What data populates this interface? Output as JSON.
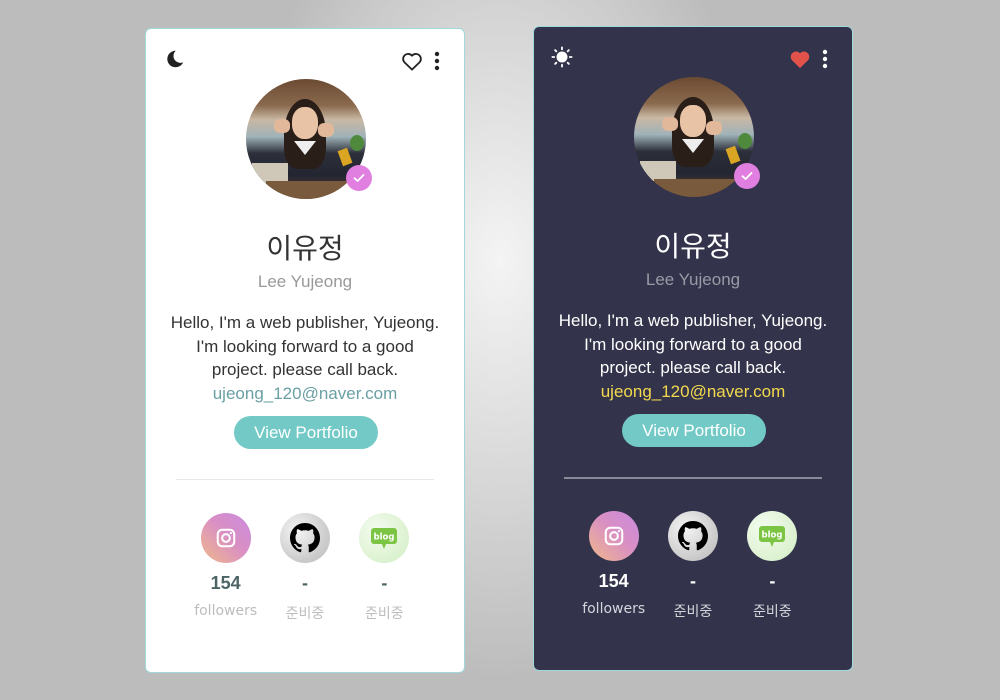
{
  "cards": [
    {
      "theme": "light",
      "theme_toggle_icon": "moon-icon",
      "favorite_icon": "heart-outline-icon",
      "favorited": false,
      "menu_icon": "more-vertical-icon",
      "verified_icon": "check-badge-icon",
      "name_ko": "이유정",
      "name_en": "Lee Yujeong",
      "bio": "Hello, I'm a web publisher, Yujeong. I'm looking forward to a good project. please call back.",
      "email": "ujeong_120@naver.com",
      "portfolio_button": "View Portfolio",
      "socials": [
        {
          "platform": "instagram",
          "icon": "instagram-icon",
          "count": "154",
          "label": "followers"
        },
        {
          "platform": "github",
          "icon": "github-icon",
          "count": "-",
          "label": "준비중"
        },
        {
          "platform": "blog",
          "icon": "naver-blog-icon",
          "icon_text": "blog",
          "count": "-",
          "label": "준비중"
        }
      ]
    },
    {
      "theme": "dark",
      "theme_toggle_icon": "sun-icon",
      "favorite_icon": "heart-filled-icon",
      "favorited": true,
      "menu_icon": "more-vertical-icon",
      "verified_icon": "check-badge-icon",
      "name_ko": "이유정",
      "name_en": "Lee Yujeong",
      "bio": "Hello, I'm a web publisher, Yujeong. I'm looking forward to a good project. please call back.",
      "email": "ujeong_120@naver.com",
      "portfolio_button": "View Portfolio",
      "socials": [
        {
          "platform": "instagram",
          "icon": "instagram-icon",
          "count": "154",
          "label": "followers"
        },
        {
          "platform": "github",
          "icon": "github-icon",
          "count": "-",
          "label": "준비중"
        },
        {
          "platform": "blog",
          "icon": "naver-blog-icon",
          "icon_text": "blog",
          "count": "-",
          "label": "준비중"
        }
      ]
    }
  ],
  "colors": {
    "accent_teal": "#72c9c6",
    "verified_pink": "#e07fe0",
    "heart_red": "#e0524a",
    "dark_bg": "#33334b",
    "email_light": "#6a9fa4",
    "email_dark": "#f2d94e"
  }
}
